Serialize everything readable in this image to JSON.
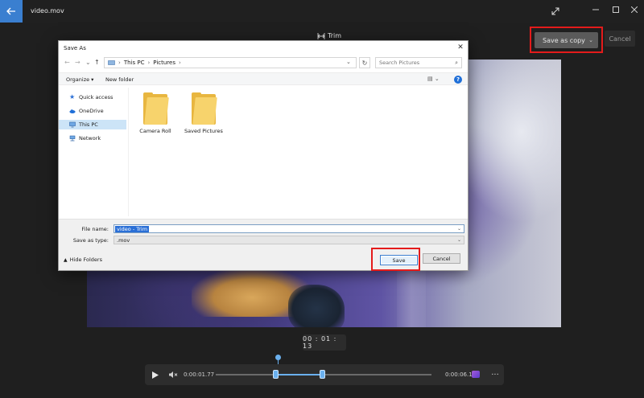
{
  "app": {
    "title": "video.mov",
    "mode_label": "Trim",
    "save_as_copy_label": "Save as copy",
    "cancel_label": "Cancel"
  },
  "player": {
    "current_time": "00 : 01 : 13",
    "start_time": "0:00:01.77",
    "end_time": "0:00:06.10"
  },
  "dialog": {
    "title": "Save As",
    "breadcrumb": [
      "This PC",
      "Pictures"
    ],
    "search_placeholder": "Search Pictures",
    "toolbar": {
      "organize_label": "Organize ▾",
      "new_folder_label": "New folder"
    },
    "nav_items": [
      {
        "label": "Quick access",
        "icon": "star-icon",
        "selected": false
      },
      {
        "label": "OneDrive",
        "icon": "cloud-icon",
        "selected": false
      },
      {
        "label": "This PC",
        "icon": "computer-icon",
        "selected": true
      },
      {
        "label": "Network",
        "icon": "network-icon",
        "selected": false
      }
    ],
    "folders": [
      {
        "label": "Camera Roll"
      },
      {
        "label": "Saved Pictures"
      }
    ],
    "file_name_label": "File name:",
    "file_name_value": "video - Trim",
    "save_as_type_label": "Save as type:",
    "save_as_type_value": ".mov",
    "hide_folders_label": "Hide Folders",
    "save_label": "Save",
    "cancel_label": "Cancel"
  },
  "colors": {
    "accent": "#3a7fd0",
    "highlight_box": "#e41b1b",
    "timeline": "#6ab0ee"
  }
}
